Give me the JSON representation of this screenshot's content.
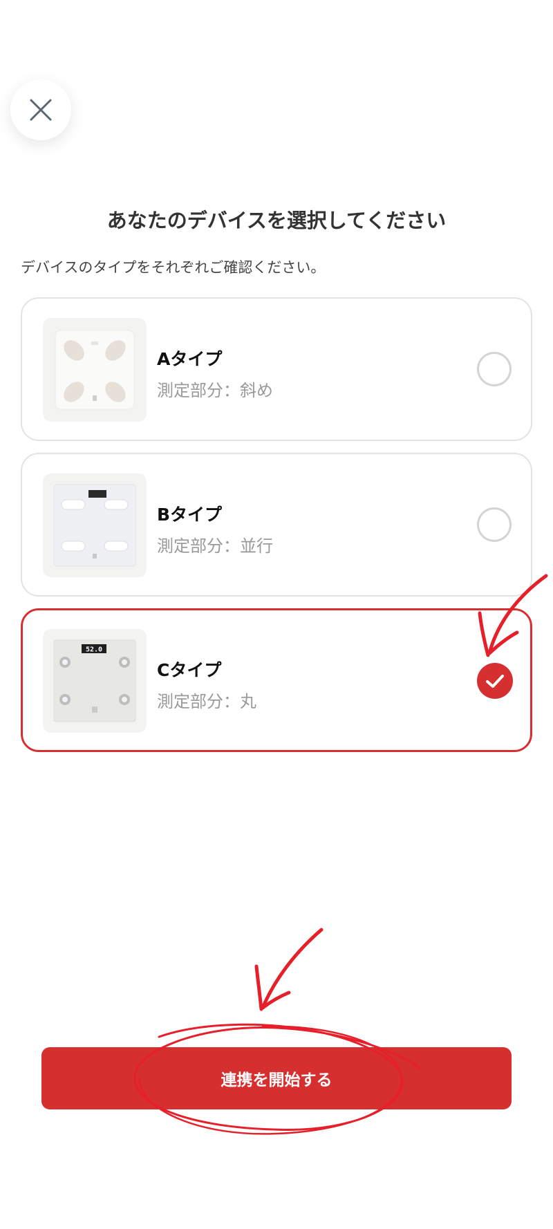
{
  "header": {
    "close_icon": "close-icon"
  },
  "main": {
    "title": "あなたのデバイスを選択してください",
    "subtitle": "デバイスのタイプをそれぞれご確認ください。",
    "devices": [
      {
        "name": "Aタイプ",
        "detail": "測定部分：斜め",
        "selected": false
      },
      {
        "name": "Bタイプ",
        "detail": "測定部分：並行",
        "selected": false
      },
      {
        "name": "Cタイプ",
        "detail": "測定部分：丸",
        "selected": true,
        "display_reading": "52.0"
      }
    ]
  },
  "footer": {
    "start_label": "連携を開始する"
  },
  "colors": {
    "accent": "#d62f2f",
    "annotation": "#e5202a",
    "border": "#e3e3e3",
    "muted_text": "#9a9a9a"
  }
}
